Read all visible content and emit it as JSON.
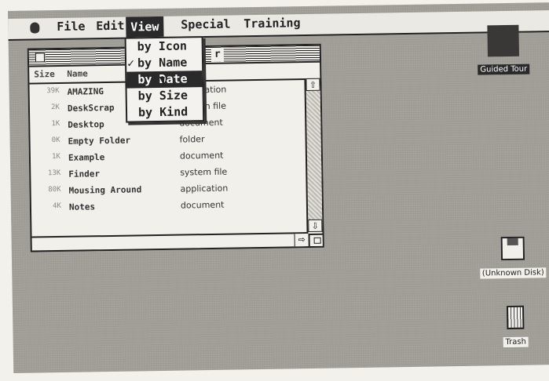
{
  "menubar": {
    "items": [
      "File",
      "Edit",
      "View",
      "Special",
      "Training"
    ]
  },
  "view_menu": {
    "items": [
      {
        "label": "by Icon",
        "checked": false,
        "selected": false
      },
      {
        "label": "by Name",
        "checked": true,
        "selected": false
      },
      {
        "label": "by Date",
        "checked": false,
        "selected": true
      },
      {
        "label": "by Size",
        "checked": false,
        "selected": false
      },
      {
        "label": "by Kind",
        "checked": false,
        "selected": false
      }
    ],
    "check_glyph": "✓"
  },
  "window": {
    "title_fragment": "r",
    "headers": {
      "size": "Size",
      "name": "Name"
    },
    "rows": [
      {
        "size": "39K",
        "name": "AMAZING",
        "kind": "application"
      },
      {
        "size": "2K",
        "name": "DeskScrap",
        "kind": "system file"
      },
      {
        "size": "1K",
        "name": "Desktop",
        "kind": "document"
      },
      {
        "size": "0K",
        "name": "Empty Folder",
        "kind": "folder"
      },
      {
        "size": "1K",
        "name": "Example",
        "kind": "document"
      },
      {
        "size": "13K",
        "name": "Finder",
        "kind": "system file"
      },
      {
        "size": "80K",
        "name": "Mousing Around",
        "kind": "application"
      },
      {
        "size": "4K",
        "name": "Notes",
        "kind": "document"
      }
    ],
    "scroll_up_icon": "⇧",
    "scroll_down_icon": "⇩",
    "scroll_right_icon": "⇨"
  },
  "desktop": {
    "icons": [
      {
        "label": "Guided Tour",
        "icon": "tour-icon"
      },
      {
        "label": "(Unknown Disk)",
        "icon": "floppy-disk-icon"
      },
      {
        "label": "Trash",
        "icon": "trash-icon"
      }
    ]
  }
}
